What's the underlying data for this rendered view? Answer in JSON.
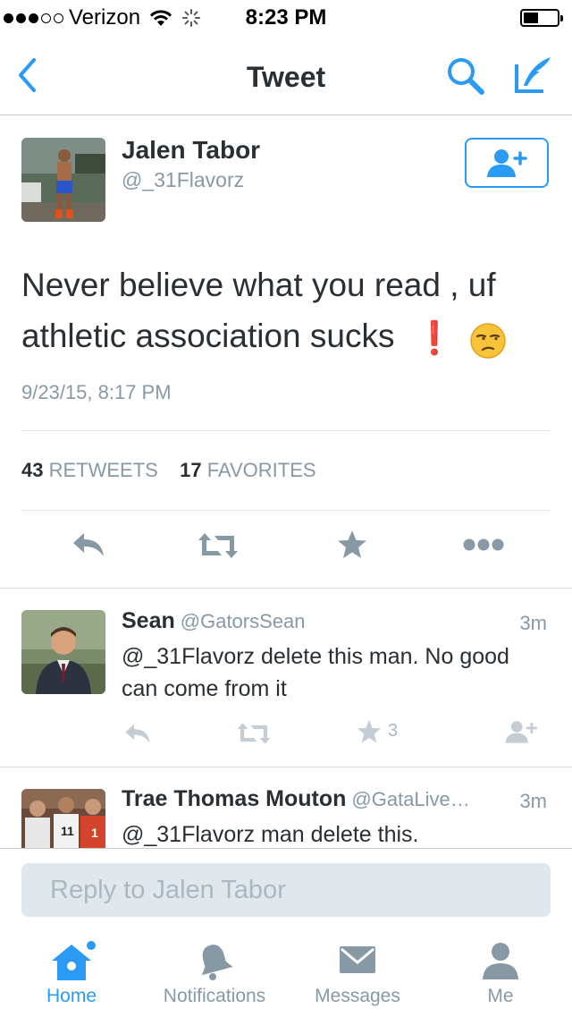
{
  "status_bar": {
    "carrier": "Verizon",
    "time": "8:23 PM",
    "signal_bars": 3,
    "battery_level": 0.45
  },
  "nav": {
    "title": "Tweet",
    "back_icon": "chevron-left-icon",
    "search_icon": "search-icon",
    "compose_icon": "compose-icon",
    "accent": "#2b9af3"
  },
  "tweet": {
    "author_name": "Jalen Tabor",
    "author_handle": "@_31Flavorz",
    "text": "Never believe what you read , uf athletic association sucks",
    "emoji": [
      "❗",
      "😒"
    ],
    "timestamp": "9/23/15, 8:17 PM",
    "retweets_count": "43",
    "retweets_label": "RETWEETS",
    "favorites_count": "17",
    "favorites_label": "FAVORITES",
    "follow_icon": "follow-icon"
  },
  "replies": [
    {
      "name": "Sean",
      "handle": "@GatorsSean",
      "time": "3m",
      "text": "@_31Flavorz delete this man.  No good can come from it",
      "favorites": "3"
    },
    {
      "name": "Trae Thomas Mouton",
      "handle": "@GataLive…",
      "time": "3m",
      "text": "@_31Flavorz man delete this."
    }
  ],
  "reply_box": {
    "placeholder": "Reply to Jalen Tabor"
  },
  "tabs": [
    {
      "label": "Home",
      "icon": "home-icon",
      "active": true
    },
    {
      "label": "Notifications",
      "icon": "bell-icon",
      "active": false
    },
    {
      "label": "Messages",
      "icon": "envelope-icon",
      "active": false
    },
    {
      "label": "Me",
      "icon": "person-icon",
      "active": false
    }
  ]
}
